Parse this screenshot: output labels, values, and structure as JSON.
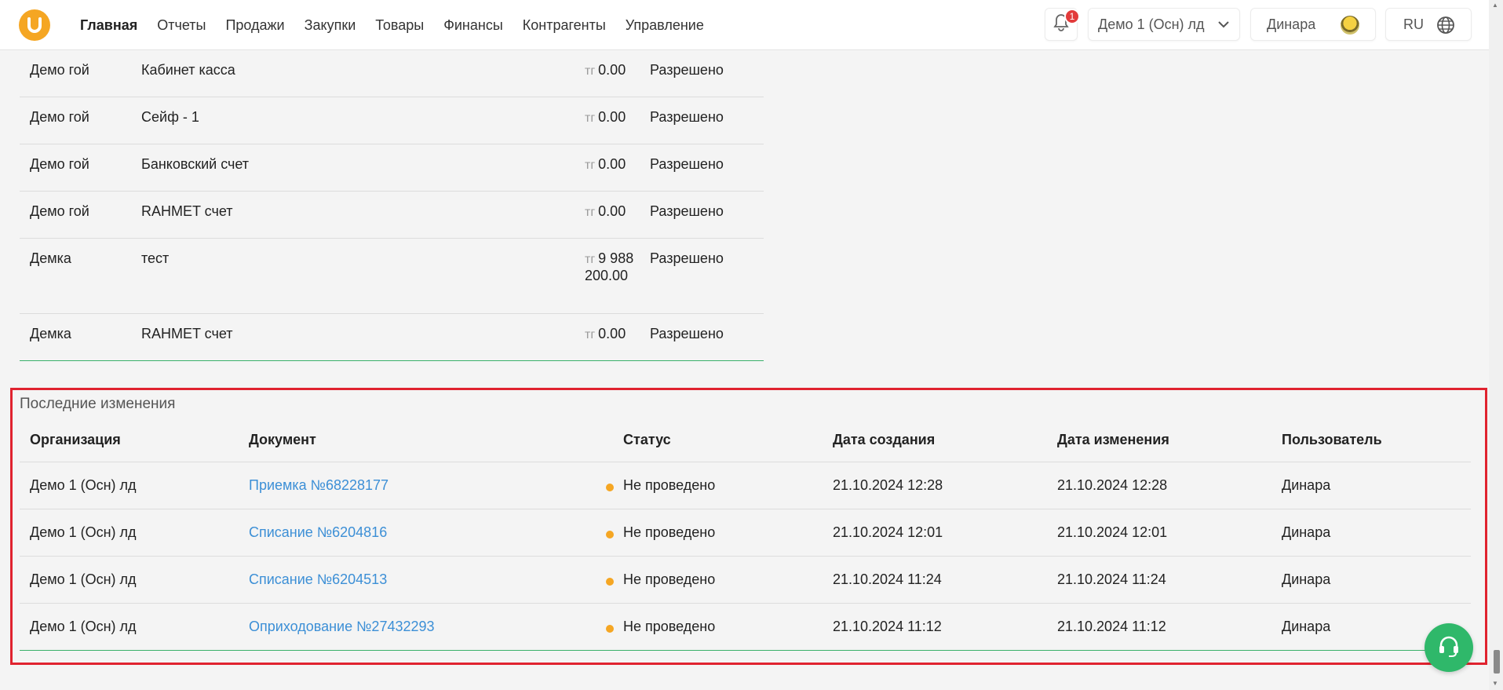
{
  "header": {
    "nav": [
      {
        "label": "Главная",
        "active": true
      },
      {
        "label": "Отчеты",
        "active": false
      },
      {
        "label": "Продажи",
        "active": false
      },
      {
        "label": "Закупки",
        "active": false
      },
      {
        "label": "Товары",
        "active": false
      },
      {
        "label": "Финансы",
        "active": false
      },
      {
        "label": "Контрагенты",
        "active": false
      },
      {
        "label": "Управление",
        "active": false
      }
    ],
    "notification_count": "1",
    "organization": "Демо 1 (Осн) лд",
    "user_name": "Динара",
    "language": "RU"
  },
  "accounts": [
    {
      "org": "Демо гой",
      "name": "Кабинет касса",
      "currency": "тг",
      "amount": "0.00",
      "status": "Разрешено"
    },
    {
      "org": "Демо гой",
      "name": "Сейф - 1",
      "currency": "тг",
      "amount": "0.00",
      "status": "Разрешено"
    },
    {
      "org": "Демо гой",
      "name": "Банковский счет",
      "currency": "тг",
      "amount": "0.00",
      "status": "Разрешено"
    },
    {
      "org": "Демо гой",
      "name": "RAHMET счет",
      "currency": "тг",
      "amount": "0.00",
      "status": "Разрешено"
    },
    {
      "org": "Демка",
      "name": "тест",
      "currency": "тг",
      "amount": "9 988 200.00",
      "status": "Разрешено"
    },
    {
      "org": "Демка",
      "name": "RAHMET счет",
      "currency": "тг",
      "amount": "0.00",
      "status": "Разрешено"
    }
  ],
  "recent": {
    "title": "Последние изменения",
    "columns": {
      "org": "Организация",
      "doc": "Документ",
      "status": "Статус",
      "created": "Дата создания",
      "changed": "Дата изменения",
      "user": "Пользователь"
    },
    "rows": [
      {
        "org": "Демо 1 (Осн) лд",
        "doc": "Приемка №68228177",
        "status": "Не проведено",
        "created": "21.10.2024 12:28",
        "changed": "21.10.2024 12:28",
        "user": "Динара"
      },
      {
        "org": "Демо 1 (Осн) лд",
        "doc": "Списание №6204816",
        "status": "Не проведено",
        "created": "21.10.2024 12:01",
        "changed": "21.10.2024 12:01",
        "user": "Динара"
      },
      {
        "org": "Демо 1 (Осн) лд",
        "doc": "Списание №6204513",
        "status": "Не проведено",
        "created": "21.10.2024 11:24",
        "changed": "21.10.2024 11:24",
        "user": "Динара"
      },
      {
        "org": "Демо 1 (Осн) лд",
        "doc": "Оприходование №27432293",
        "status": "Не проведено",
        "created": "21.10.2024 11:12",
        "changed": "21.10.2024 11:12",
        "user": "Динара"
      }
    ]
  },
  "colors": {
    "brand": "#f5a623",
    "link": "#3c8fd6",
    "status_dot": "#f5a623",
    "support": "#2fb86a",
    "highlight": "#e0232f"
  },
  "icons": {
    "logo": "logo-icon",
    "bell": "bell-icon",
    "chevron": "chevron-down-icon",
    "globe": "globe-icon",
    "support": "headset-icon"
  }
}
